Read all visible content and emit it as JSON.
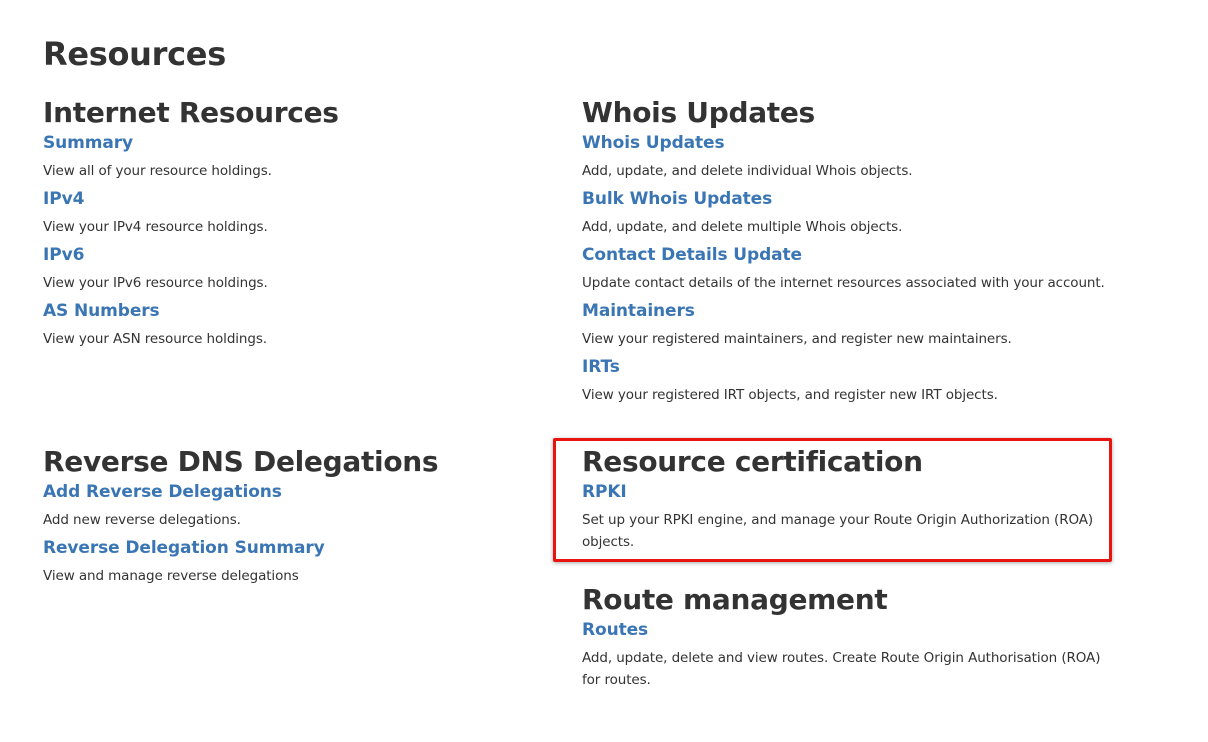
{
  "page": {
    "title": "Resources"
  },
  "internet_resources": {
    "heading": "Internet Resources",
    "items": [
      {
        "label": "Summary",
        "desc": "View all of your resource holdings."
      },
      {
        "label": "IPv4",
        "desc": "View your IPv4 resource holdings."
      },
      {
        "label": "IPv6",
        "desc": "View your IPv6 resource holdings."
      },
      {
        "label": "AS Numbers",
        "desc": "View your ASN resource holdings."
      }
    ]
  },
  "whois_updates": {
    "heading": "Whois Updates",
    "items": [
      {
        "label": "Whois Updates",
        "desc": "Add, update, and delete individual Whois objects."
      },
      {
        "label": "Bulk Whois Updates",
        "desc": "Add, update, and delete multiple Whois objects."
      },
      {
        "label": "Contact Details Update",
        "desc": "Update contact details of the internet resources associated with your account."
      },
      {
        "label": "Maintainers",
        "desc": "View your registered maintainers, and register new maintainers."
      },
      {
        "label": "IRTs",
        "desc": "View your registered IRT objects, and register new IRT objects."
      }
    ]
  },
  "reverse_dns": {
    "heading": "Reverse DNS Delegations",
    "items": [
      {
        "label": "Add Reverse Delegations",
        "desc": "Add new reverse delegations."
      },
      {
        "label": "Reverse Delegation Summary",
        "desc": "View and manage reverse delegations"
      }
    ]
  },
  "resource_certification": {
    "heading": "Resource certification",
    "items": [
      {
        "label": "RPKI",
        "desc": "Set up your RPKI engine, and manage your Route Origin Authorization (ROA) objects."
      }
    ]
  },
  "route_management": {
    "heading": "Route management",
    "items": [
      {
        "label": "Routes",
        "desc": "Add, update, delete and view routes. Create Route Origin Authorisation (ROA) for routes."
      }
    ]
  },
  "colors": {
    "link": "#3a75b4",
    "text": "#333333",
    "highlight": "#e8140f"
  }
}
